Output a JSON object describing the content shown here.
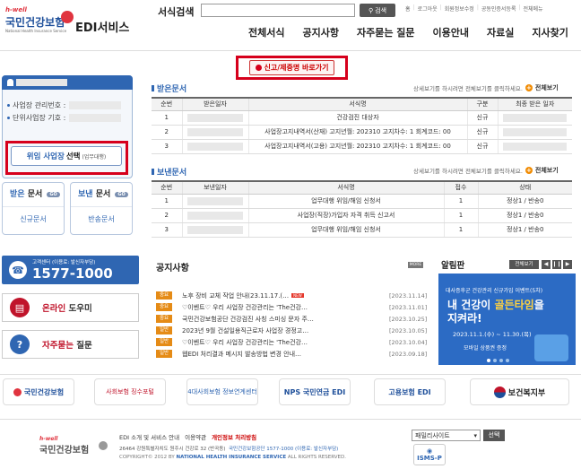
{
  "header": {
    "logo": {
      "top": "h-well",
      "main": "국민건강보험",
      "sub": "National Health Insurance Service"
    },
    "service_title": "EDI서비스",
    "search": {
      "label": "서식검색",
      "value": "",
      "button": "검색"
    },
    "top_links": [
      "홈",
      "로그아웃",
      "회원정보수정",
      "공동인증서등록",
      "전체메뉴"
    ],
    "nav": [
      "전체서식",
      "공지사항",
      "자주묻는 질문",
      "이용안내",
      "자료실",
      "지사찾기"
    ],
    "report_button": "신고/제증명 바로가기"
  },
  "sidebar": {
    "info_labels": [
      "사업장 관리번호 :",
      "단위사업장 기호 :"
    ],
    "proxy_button": {
      "main": "위임 사업장",
      "bold": "선택",
      "small": "(업무대행)"
    },
    "received_box": {
      "title_blue": "받은",
      "title_rest": "문서",
      "go": "GO",
      "link": "신규문서"
    },
    "sent_box": {
      "title_blue": "보낸",
      "title_rest": "문서",
      "go": "GO",
      "link": "반송문서"
    },
    "cs": {
      "small": "고객센터 (이용료: 발신자부담)",
      "number": "1577-1000"
    },
    "online_help": {
      "accent": "온라인",
      "rest": "도우미"
    },
    "faq": {
      "accent": "자주묻는",
      "rest": "질문"
    }
  },
  "received": {
    "title": "받은문서",
    "note": "상세보기를 하시려면 전체보기를 클릭하세요.",
    "see_all": "전체보기",
    "columns": [
      "순번",
      "받은일자",
      "서식명",
      "구분",
      "최종 받은 일자"
    ],
    "rows": [
      {
        "no": "1",
        "name": "건강검진 대상자",
        "type": "신규"
      },
      {
        "no": "2",
        "name": "사업장고지내역서(산재) 고지년월: 202310 고지차수: 1 회계코드: 00",
        "type": "신규"
      },
      {
        "no": "3",
        "name": "사업장고지내역서(고용) 고지년월: 202310 고지차수: 1 회계코드: 00",
        "type": "신규"
      }
    ]
  },
  "sent": {
    "title": "보낸문서",
    "note": "상세보기를 하시려면 전체보기를 클릭하세요.",
    "see_all": "전체보기",
    "columns": [
      "순번",
      "보낸일자",
      "서식명",
      "접수",
      "상태"
    ],
    "rows": [
      {
        "no": "1",
        "name": "업무대행 위임/해임 신청서",
        "count": "1",
        "status": "정상1 / 반송0"
      },
      {
        "no": "2",
        "name": "사업장(직장)가입자 자격 취득 신고서",
        "count": "1",
        "status": "정상1 / 반송0"
      },
      {
        "no": "3",
        "name": "업무대행 위임/해임 신청서",
        "count": "1",
        "status": "정상1 / 반송0"
      }
    ]
  },
  "notice": {
    "title": "공지사항",
    "more": "MORE",
    "items": [
      {
        "tag": "중요",
        "text": "노후 장비 교체 작업 안내(23.11.17.(…",
        "new": "NEW",
        "date": "[2023.11.14]"
      },
      {
        "tag": "중요",
        "text": "♡이벤트♡ 우리 사업장 건강관리는 'The건강…",
        "new": "",
        "date": "[2023.11.01]"
      },
      {
        "tag": "중요",
        "text": "국민건강보험공단 건강검진 사칭 스미싱 문자 주…",
        "new": "",
        "date": "[2023.10.25]"
      },
      {
        "tag": "일반",
        "text": "2023년 9월 건설일용직근로자 사업장 경정고…",
        "new": "",
        "date": "[2023.10.05]"
      },
      {
        "tag": "일반",
        "text": "♡이벤트♡ 우리 사업장 건강관리는 'The건강…",
        "new": "",
        "date": "[2023.10.04]"
      },
      {
        "tag": "일반",
        "text": "웹EDI 처리결과 메시지 발송방법 변경 안내…",
        "new": "",
        "date": "[2023.09.18]"
      }
    ]
  },
  "alarm": {
    "title": "알림판",
    "all": "전체보기",
    "banner": {
      "line1": "대사증후군 건강관리 신규가입 이벤트(5차)",
      "line2a": "내 건강이",
      "line2b": "골든타임",
      "line2c": "을",
      "line3": "지켜라!",
      "period": "2023.11.1.(수) ~ 11.30.(목)",
      "prize": "모바일 상품권 증정"
    }
  },
  "partners": [
    "국민건강보험",
    "사회보험 징수포털",
    "4대사회보험 정보연계센터",
    "NPS 국민연금 EDI",
    "고용보험 EDI",
    "보건복지부"
  ],
  "footer": {
    "links": [
      "EDI 소개 및 서비스 안내",
      "이용약관",
      "개인정보 처리방침"
    ],
    "address": "26464 강원특별자치도 원주시 건강로 32 (반곡동)",
    "phone": "국민건강보험공단 1577-1000 (이용료: 발신자부담)",
    "copyright_pre": "COPYRIGHT© 2012 BY",
    "copyright_org": "NATIONAL HEALTH INSURANCE SERVICE",
    "copyright_post": "ALL RIGHTS RESERVED.",
    "family_site": "패밀리사이트",
    "family_btn": "선택",
    "isms": "ISMS-P"
  },
  "colors": {
    "brand_blue": "#2f66b2",
    "alert_red": "#d6001c",
    "tag_orange": "#e58b16"
  }
}
